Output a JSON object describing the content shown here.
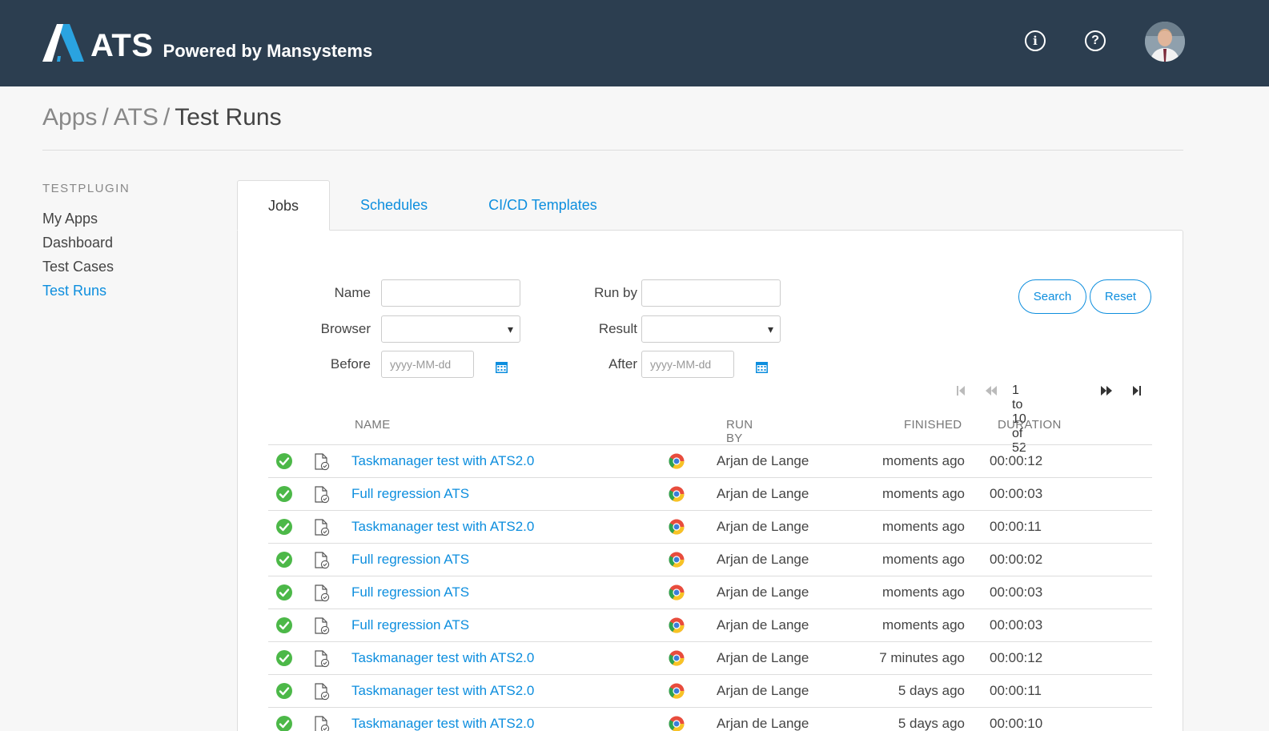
{
  "header": {
    "brand": "ATS",
    "tagline": "Powered by Mansystems",
    "icons": [
      "info-icon",
      "help-icon",
      "avatar"
    ]
  },
  "breadcrumb": {
    "items": [
      "Apps",
      "ATS",
      "Test Runs"
    ],
    "separator": "/"
  },
  "sidebar": {
    "title": "TESTPLUGIN",
    "items": [
      {
        "label": "My Apps"
      },
      {
        "label": "Dashboard"
      },
      {
        "label": "Test Cases"
      },
      {
        "label": "Test Runs",
        "active": true
      }
    ]
  },
  "tabs": [
    {
      "label": "Jobs",
      "active": true
    },
    {
      "label": "Schedules"
    },
    {
      "label": "CI/CD Templates"
    }
  ],
  "filters": {
    "name_label": "Name",
    "name_value": "",
    "runby_label": "Run by",
    "runby_value": "",
    "browser_label": "Browser",
    "browser_value": "",
    "result_label": "Result",
    "result_value": "",
    "before_label": "Before",
    "before_placeholder": "yyyy-MM-dd",
    "after_label": "After",
    "after_placeholder": "yyyy-MM-dd",
    "search_label": "Search",
    "reset_label": "Reset"
  },
  "pager": {
    "text": "1 to 10 of 52"
  },
  "table": {
    "columns": {
      "name": "NAME",
      "run_by": "RUN BY",
      "finished": "FINISHED",
      "duration": "DURATION"
    },
    "rows": [
      {
        "status": "passed",
        "name": "Taskmanager test with ATS2.0",
        "browser": "chrome",
        "run_by": "Arjan de Lange",
        "finished": "moments ago",
        "duration": "00:00:12"
      },
      {
        "status": "passed",
        "name": "Full regression ATS",
        "browser": "chrome",
        "run_by": "Arjan de Lange",
        "finished": "moments ago",
        "duration": "00:00:03"
      },
      {
        "status": "passed",
        "name": "Taskmanager test with ATS2.0",
        "browser": "chrome",
        "run_by": "Arjan de Lange",
        "finished": "moments ago",
        "duration": "00:00:11"
      },
      {
        "status": "passed",
        "name": "Full regression ATS",
        "browser": "chrome",
        "run_by": "Arjan de Lange",
        "finished": "moments ago",
        "duration": "00:00:02"
      },
      {
        "status": "passed",
        "name": "Full regression ATS",
        "browser": "chrome",
        "run_by": "Arjan de Lange",
        "finished": "moments ago",
        "duration": "00:00:03"
      },
      {
        "status": "passed",
        "name": "Full regression ATS",
        "browser": "chrome",
        "run_by": "Arjan de Lange",
        "finished": "moments ago",
        "duration": "00:00:03"
      },
      {
        "status": "passed",
        "name": "Taskmanager test with ATS2.0",
        "browser": "chrome",
        "run_by": "Arjan de Lange",
        "finished": "7 minutes ago",
        "duration": "00:00:12"
      },
      {
        "status": "passed",
        "name": "Taskmanager test with ATS2.0",
        "browser": "chrome",
        "run_by": "Arjan de Lange",
        "finished": "5 days ago",
        "duration": "00:00:11"
      },
      {
        "status": "passed",
        "name": "Taskmanager test with ATS2.0",
        "browser": "chrome",
        "run_by": "Arjan de Lange",
        "finished": "5 days ago",
        "duration": "00:00:10"
      }
    ]
  },
  "colors": {
    "header_bg": "#2c3e50",
    "accent": "#0d8ede",
    "success": "#4cb848",
    "logo_blue": "#2aa3e0"
  }
}
